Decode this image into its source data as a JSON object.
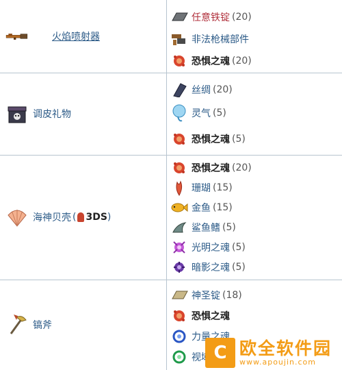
{
  "rows": [
    {
      "result": {
        "name": "火焰喷射器",
        "icon": "flamethrower-icon",
        "linked": true
      },
      "materials": [
        {
          "name": "任意铁锭",
          "qty": "(20)",
          "style": "red",
          "icon": "iron-bar-icon"
        },
        {
          "name": "非法枪械部件",
          "qty": "",
          "style": "normal",
          "icon": "gun-parts-icon"
        },
        {
          "name": "恐惧之魂",
          "qty": "(20)",
          "style": "bold",
          "icon": "soul-of-fright-icon"
        }
      ]
    },
    {
      "result": {
        "name": "调皮礼物",
        "icon": "naughty-present-icon",
        "linked": false
      },
      "materials": [
        {
          "name": "丝绸",
          "qty": "(20)",
          "style": "normal",
          "icon": "silk-icon"
        },
        {
          "name": "灵气",
          "qty": "(5)",
          "style": "normal",
          "icon": "ectoplasm-icon"
        },
        {
          "name": "恐惧之魂",
          "qty": "(5)",
          "style": "bold",
          "icon": "soul-of-fright-icon"
        }
      ]
    },
    {
      "result": {
        "name": "海神贝壳",
        "icon": "neptunes-shell-icon",
        "linked": false,
        "badge": "3DS"
      },
      "materials": [
        {
          "name": "恐惧之魂",
          "qty": "(20)",
          "style": "bold",
          "icon": "soul-of-fright-icon"
        },
        {
          "name": "珊瑚",
          "qty": "(15)",
          "style": "normal",
          "icon": "coral-icon"
        },
        {
          "name": "金鱼",
          "qty": "(15)",
          "style": "normal",
          "icon": "goldfish-icon"
        },
        {
          "name": "鲨鱼鳍",
          "qty": "(5)",
          "style": "normal",
          "icon": "shark-fin-icon"
        },
        {
          "name": "光明之魂",
          "qty": "(5)",
          "style": "normal",
          "icon": "soul-of-light-icon"
        },
        {
          "name": "暗影之魂",
          "qty": "(5)",
          "style": "normal",
          "icon": "soul-of-night-icon"
        }
      ]
    },
    {
      "result": {
        "name": "镐斧",
        "icon": "pickaxe-axe-icon",
        "linked": false
      },
      "materials": [
        {
          "name": "神圣锭",
          "qty": "(18)",
          "style": "normal",
          "icon": "hallowed-bar-icon"
        },
        {
          "name": "恐惧之魂",
          "qty": "",
          "style": "bold",
          "icon": "soul-of-fright-icon"
        },
        {
          "name": "力量之魂",
          "qty": "",
          "style": "normal",
          "icon": "soul-of-might-icon"
        },
        {
          "name": "视域之魂",
          "qty": "",
          "style": "normal",
          "icon": "soul-of-sight-icon"
        }
      ]
    }
  ],
  "watermark": {
    "brand": "欧全软件园",
    "url": "www.apoujin.com"
  },
  "colors": {
    "grid": "#b7c4cf",
    "link": "#2b5a87",
    "red": "#b0303c",
    "watermark": "#f39c16"
  }
}
